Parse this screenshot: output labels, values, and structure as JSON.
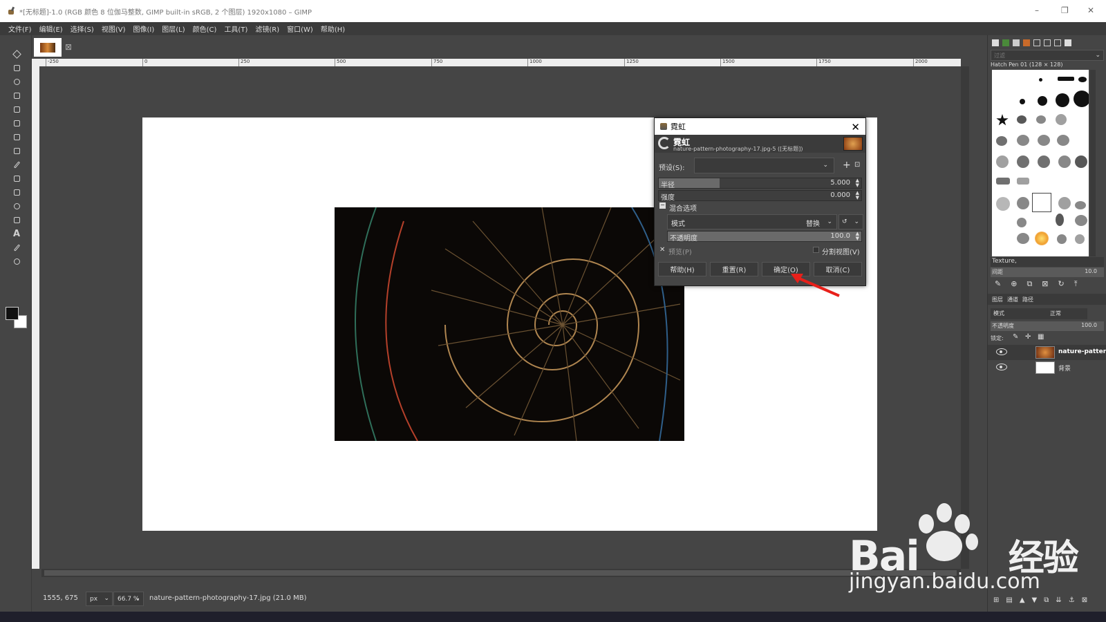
{
  "window": {
    "title": "*[无标题]-1.0 (RGB 颜色 8 位伽马整数, GIMP built-in sRGB, 2 个图层) 1920x1080 – GIMP",
    "controls": [
      "–",
      "❐",
      "✕"
    ]
  },
  "menu": [
    "文件(F)",
    "编辑(E)",
    "选择(S)",
    "视图(V)",
    "图像(I)",
    "图层(L)",
    "颜色(C)",
    "工具(T)",
    "滤镜(R)",
    "窗口(W)",
    "帮助(H)"
  ],
  "ruler": {
    "ticks": [
      "-250",
      "0",
      "250",
      "500",
      "750",
      "1000",
      "1250",
      "1500",
      "1750",
      "2000"
    ]
  },
  "status": {
    "coords": "1555, 675",
    "unit": "px",
    "zoom": "66.7 %",
    "file": "nature-pattern-photography-17.jpg (21.0 MB)"
  },
  "dialog": {
    "title": "霓虹",
    "name": "霓虹",
    "subtitle": "nature-pattern-photography-17.jpg-5 ([无标题])",
    "preset_label": "预设(S):",
    "radius_label": "半径",
    "radius_value": "5.000",
    "radius_fraction": 0.3,
    "intensity_label": "强度",
    "intensity_value": "0.000",
    "blend_section": "混合选项",
    "mode_label": "模式",
    "mode_value": "替换",
    "opacity_label": "不透明度",
    "opacity_value": "100.0",
    "preview_label": "预览(P)",
    "split_label": "分割视图(V)",
    "buttons": {
      "help": "帮助(H)",
      "reset": "重置(R)",
      "ok": "确定(O)",
      "cancel": "取消(C)"
    }
  },
  "right_panel": {
    "filter_placeholder": "过滤",
    "brush_name": "Hatch Pen 01 (128 × 128)",
    "brush_tag": "Texture,",
    "spacing_label": "间距",
    "spacing_value": "10.0",
    "tabs": [
      "图层",
      "通道",
      "路径"
    ],
    "mode_label": "模式",
    "mode_value": "正常",
    "opacity_label": "不透明度",
    "opacity_value": "100.0",
    "lock_label": "锁定:",
    "layers": [
      {
        "name": "nature-patter"
      },
      {
        "name": "背景"
      }
    ]
  },
  "watermark": {
    "brand": "Bai",
    "brand2": "经验",
    "url": "jingyan.baidu.com"
  },
  "colors": {
    "bg": "#454545",
    "arrow": "#e8201a"
  }
}
